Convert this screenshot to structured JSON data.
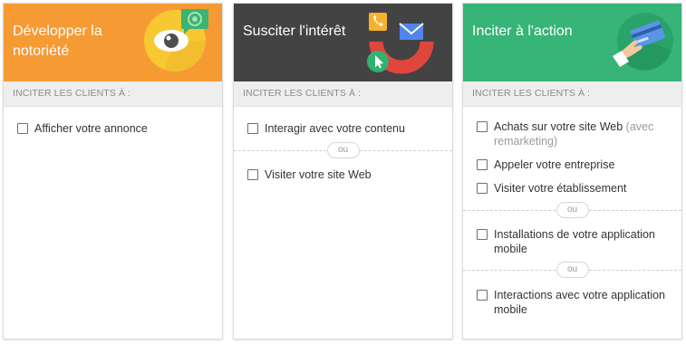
{
  "cards": [
    {
      "title": "Développer la notoriété",
      "header_color": "#f69a34",
      "icon": "eye-icon",
      "subheader": "INCITER LES CLIENTS À :",
      "options": [
        {
          "label": "Afficher votre annonce"
        }
      ]
    },
    {
      "title": "Susciter l'intérêt",
      "header_color": "#434343",
      "icon": "engagement-icon",
      "subheader": "INCITER LES CLIENTS À :",
      "options": [
        {
          "label": "Interagir avec votre contenu"
        },
        {
          "label": "Visiter votre site Web"
        }
      ],
      "divider_label": "ou"
    },
    {
      "title": "Inciter à l'action",
      "header_color": "#37b478",
      "icon": "card-payment-icon",
      "subheader": "INCITER LES CLIENTS À :",
      "options": [
        {
          "label": "Achats sur votre site Web",
          "note": "(avec remarketing)"
        },
        {
          "label": "Appeler votre entreprise"
        },
        {
          "label": "Visiter votre établissement"
        },
        {
          "label": "Installations de votre application mobile"
        },
        {
          "label": "Interactions avec votre application mobile"
        }
      ],
      "divider_label": "ou"
    }
  ]
}
